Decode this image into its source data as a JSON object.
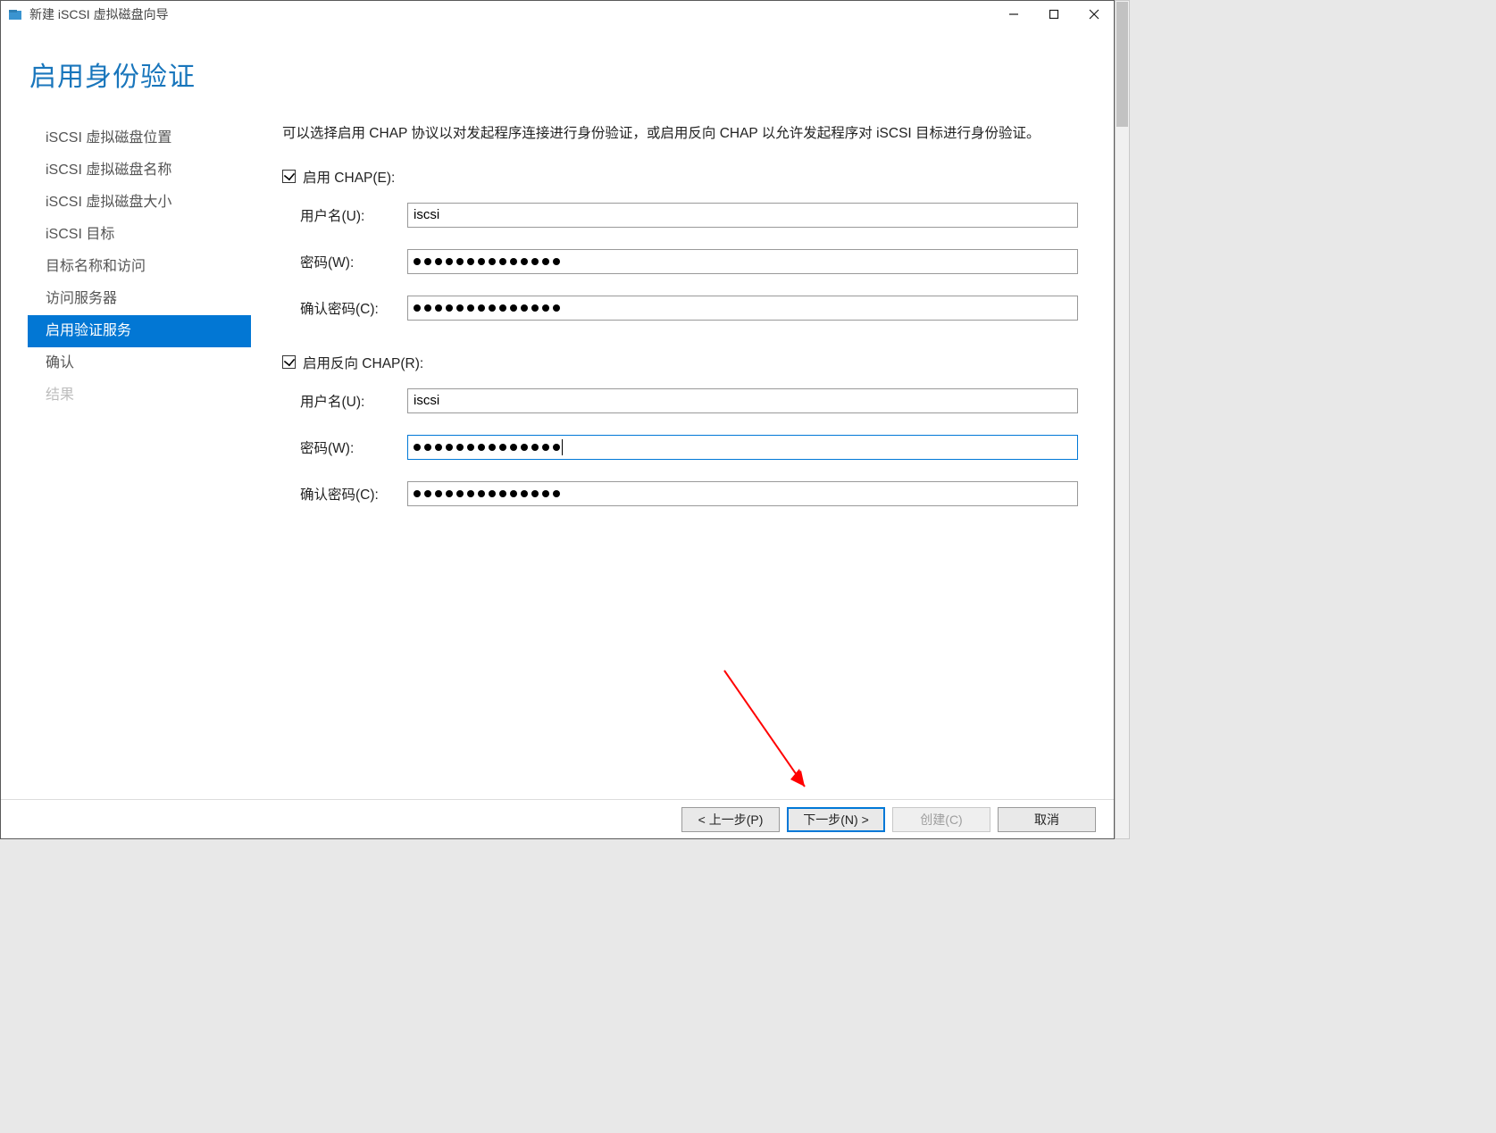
{
  "window": {
    "title": "新建 iSCSI 虚拟磁盘向导"
  },
  "heading": "启用身份验证",
  "nav": {
    "items": [
      {
        "label": "iSCSI 虚拟磁盘位置",
        "state": "done"
      },
      {
        "label": "iSCSI 虚拟磁盘名称",
        "state": "done"
      },
      {
        "label": "iSCSI 虚拟磁盘大小",
        "state": "done"
      },
      {
        "label": "iSCSI 目标",
        "state": "done"
      },
      {
        "label": "目标名称和访问",
        "state": "done"
      },
      {
        "label": "访问服务器",
        "state": "done"
      },
      {
        "label": "启用验证服务",
        "state": "active"
      },
      {
        "label": "确认",
        "state": "done"
      },
      {
        "label": "结果",
        "state": "disabled"
      }
    ]
  },
  "intro": "可以选择启用 CHAP 协议以对发起程序连接进行身份验证，或启用反向 CHAP 以允许发起程序对 iSCSI 目标进行身份验证。",
  "chap": {
    "enable_label": "启用 CHAP(E):",
    "checked": true,
    "user_label": "用户名(U):",
    "user_value": "iscsi",
    "pwd_label": "密码(W):",
    "pwd_len": 14,
    "confirm_label": "确认密码(C):",
    "confirm_len": 14
  },
  "rchap": {
    "enable_label": "启用反向 CHAP(R):",
    "checked": true,
    "user_label": "用户名(U):",
    "user_value": "iscsi",
    "pwd_label": "密码(W):",
    "pwd_len": 14,
    "pwd_focused": true,
    "confirm_label": "确认密码(C):",
    "confirm_len": 14
  },
  "buttons": {
    "prev": "< 上一步(P)",
    "next": "下一步(N) >",
    "create": "创建(C)",
    "cancel": "取消"
  }
}
